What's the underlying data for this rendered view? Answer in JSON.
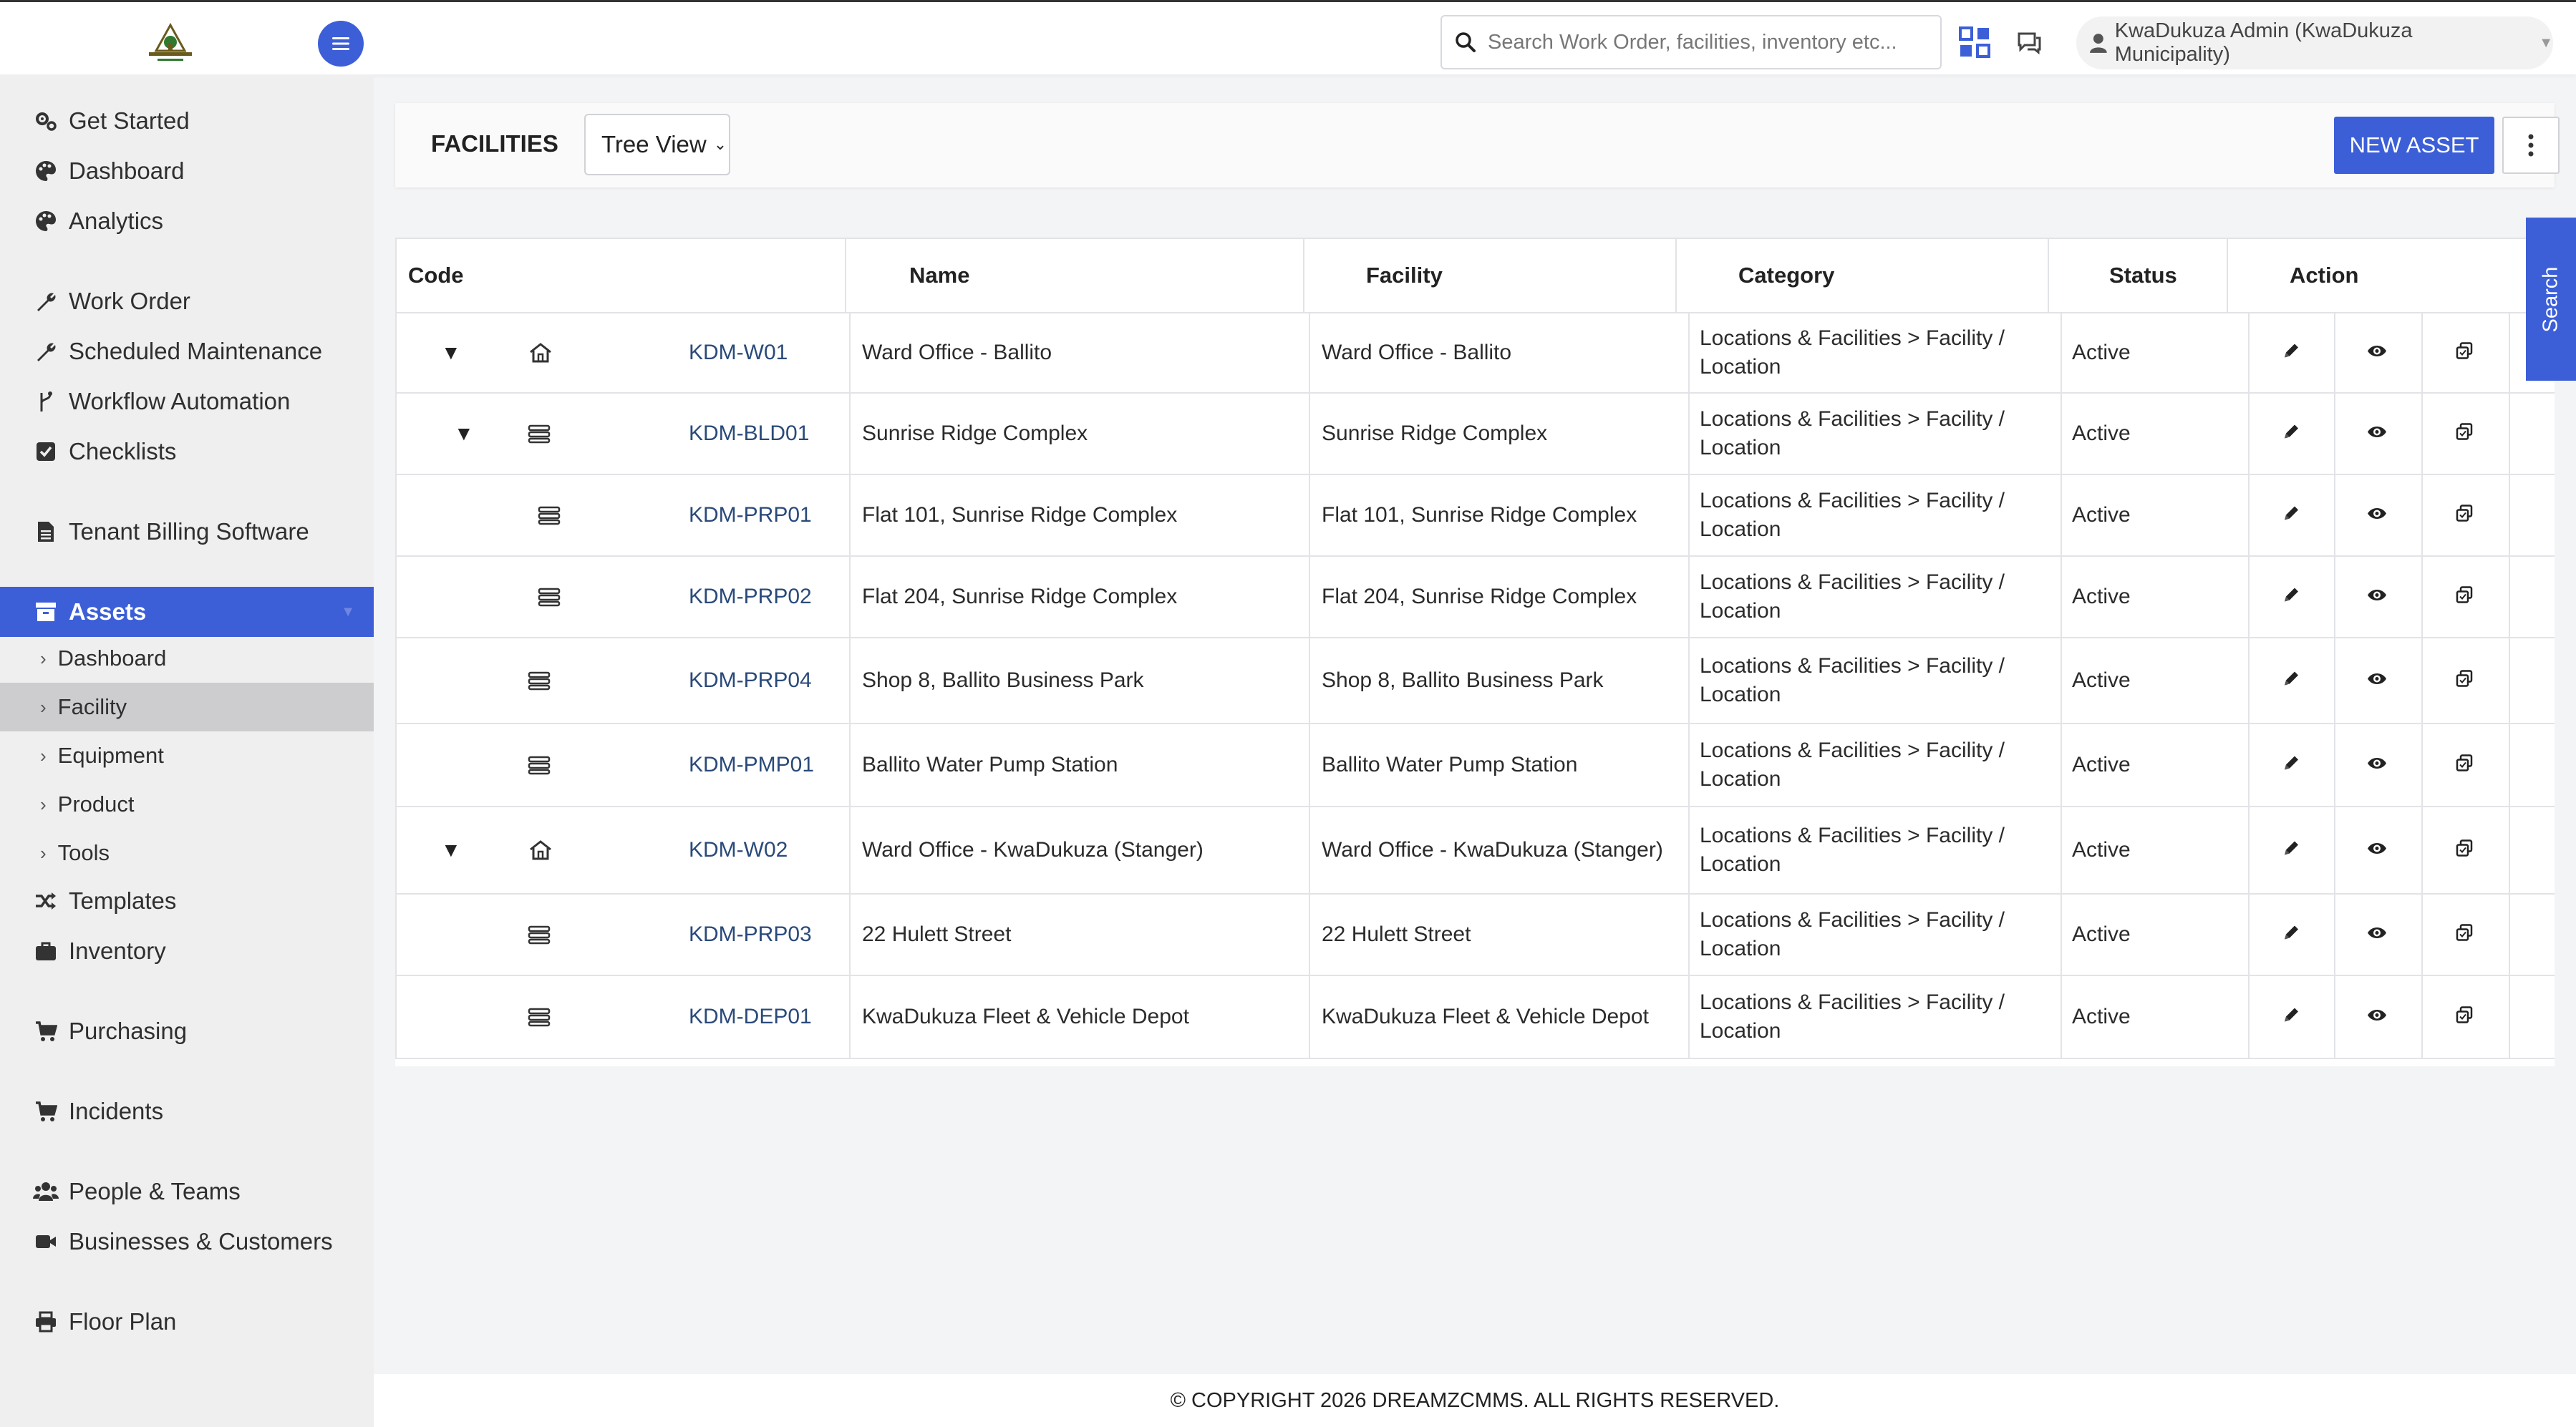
{
  "topbar": {
    "search_placeholder": "Search Work Order, facilities, inventory etc...",
    "user_label": "KwaDukuza Admin (KwaDukuza Municipality)",
    "accent_color": "#3c5fd8"
  },
  "sidebar": {
    "items": [
      {
        "label": "Get Started",
        "icon": "gears-icon"
      },
      {
        "label": "Dashboard",
        "icon": "palette-icon"
      },
      {
        "label": "Analytics",
        "icon": "palette-icon"
      },
      {
        "label": "Work Order",
        "icon": "wrench-icon"
      },
      {
        "label": "Scheduled Maintenance",
        "icon": "wrench-icon"
      },
      {
        "label": "Workflow Automation",
        "icon": "branch-icon"
      },
      {
        "label": "Checklists",
        "icon": "checkbox-icon"
      },
      {
        "label": "Tenant Billing Software",
        "icon": "document-icon"
      },
      {
        "label": "Assets",
        "icon": "archive-icon"
      },
      {
        "label": "Templates",
        "icon": "shuffle-icon"
      },
      {
        "label": "Inventory",
        "icon": "briefcase-icon"
      },
      {
        "label": "Purchasing",
        "icon": "cart-icon"
      },
      {
        "label": "Incidents",
        "icon": "cart-icon"
      },
      {
        "label": "People & Teams",
        "icon": "users-icon"
      },
      {
        "label": "Businesses & Customers",
        "icon": "video-icon"
      },
      {
        "label": "Floor Plan",
        "icon": "printer-icon"
      }
    ],
    "assets_sub": [
      "Dashboard",
      "Facility",
      "Equipment",
      "Product",
      "Tools"
    ]
  },
  "page": {
    "title": "FACILITIES",
    "view_select": "Tree View",
    "new_asset_label": "NEW ASSET",
    "search_tab_label": "Search"
  },
  "table": {
    "headers": [
      "Code",
      "Name",
      "Facility",
      "Category",
      "Status",
      "Action"
    ],
    "rows": [
      {
        "code": "KDM-W01",
        "name": "Ward Office - Ballito",
        "facility": "Ward Office - Ballito",
        "category": "Locations & Facilities > Facility / Location",
        "status": "Active",
        "level": 0,
        "expandable": true,
        "icon": "home-icon"
      },
      {
        "code": "KDM-BLD01",
        "name": "Sunrise Ridge Complex",
        "facility": "Sunrise Ridge Complex",
        "category": "Locations & Facilities > Facility / Location",
        "status": "Active",
        "level": 1,
        "expandable": true,
        "icon": "building-icon"
      },
      {
        "code": "KDM-PRP01",
        "name": "Flat 101, Sunrise Ridge Complex",
        "facility": "Flat 101, Sunrise Ridge Complex",
        "category": "Locations & Facilities > Facility / Location",
        "status": "Active",
        "level": 2,
        "expandable": false,
        "icon": "building-icon"
      },
      {
        "code": "KDM-PRP02",
        "name": "Flat 204, Sunrise Ridge Complex",
        "facility": "Flat 204, Sunrise Ridge Complex",
        "category": "Locations & Facilities > Facility / Location",
        "status": "Active",
        "level": 2,
        "expandable": false,
        "icon": "building-icon"
      },
      {
        "code": "KDM-PRP04",
        "name": "Shop 8, Ballito Business Park",
        "facility": "Shop 8, Ballito Business Park",
        "category": "Locations & Facilities > Facility / Location",
        "status": "Active",
        "level": 1,
        "expandable": false,
        "icon": "building-icon"
      },
      {
        "code": "KDM-PMP01",
        "name": "Ballito Water Pump Station",
        "facility": "Ballito Water Pump Station",
        "category": "Locations & Facilities > Facility / Location",
        "status": "Active",
        "level": 1,
        "expandable": false,
        "icon": "building-icon"
      },
      {
        "code": "KDM-W02",
        "name": "Ward Office - KwaDukuza (Stanger)",
        "facility": "Ward Office - KwaDukuza (Stanger)",
        "category": "Locations & Facilities > Facility / Location",
        "status": "Active",
        "level": 0,
        "expandable": true,
        "icon": "home-icon"
      },
      {
        "code": "KDM-PRP03",
        "name": "22 Hulett Street",
        "facility": "22 Hulett Street",
        "category": "Locations & Facilities > Facility / Location",
        "status": "Active",
        "level": 1,
        "expandable": false,
        "icon": "building-icon"
      },
      {
        "code": "KDM-DEP01",
        "name": "KwaDukuza Fleet & Vehicle Depot",
        "facility": "KwaDukuza Fleet & Vehicle Depot",
        "category": "Locations & Facilities > Facility / Location",
        "status": "Active",
        "level": 1,
        "expandable": false,
        "icon": "building-icon"
      }
    ]
  },
  "footer": {
    "copyright": "© COPYRIGHT 2026 DREAMZCMMS. ALL RIGHTS RESERVED."
  }
}
